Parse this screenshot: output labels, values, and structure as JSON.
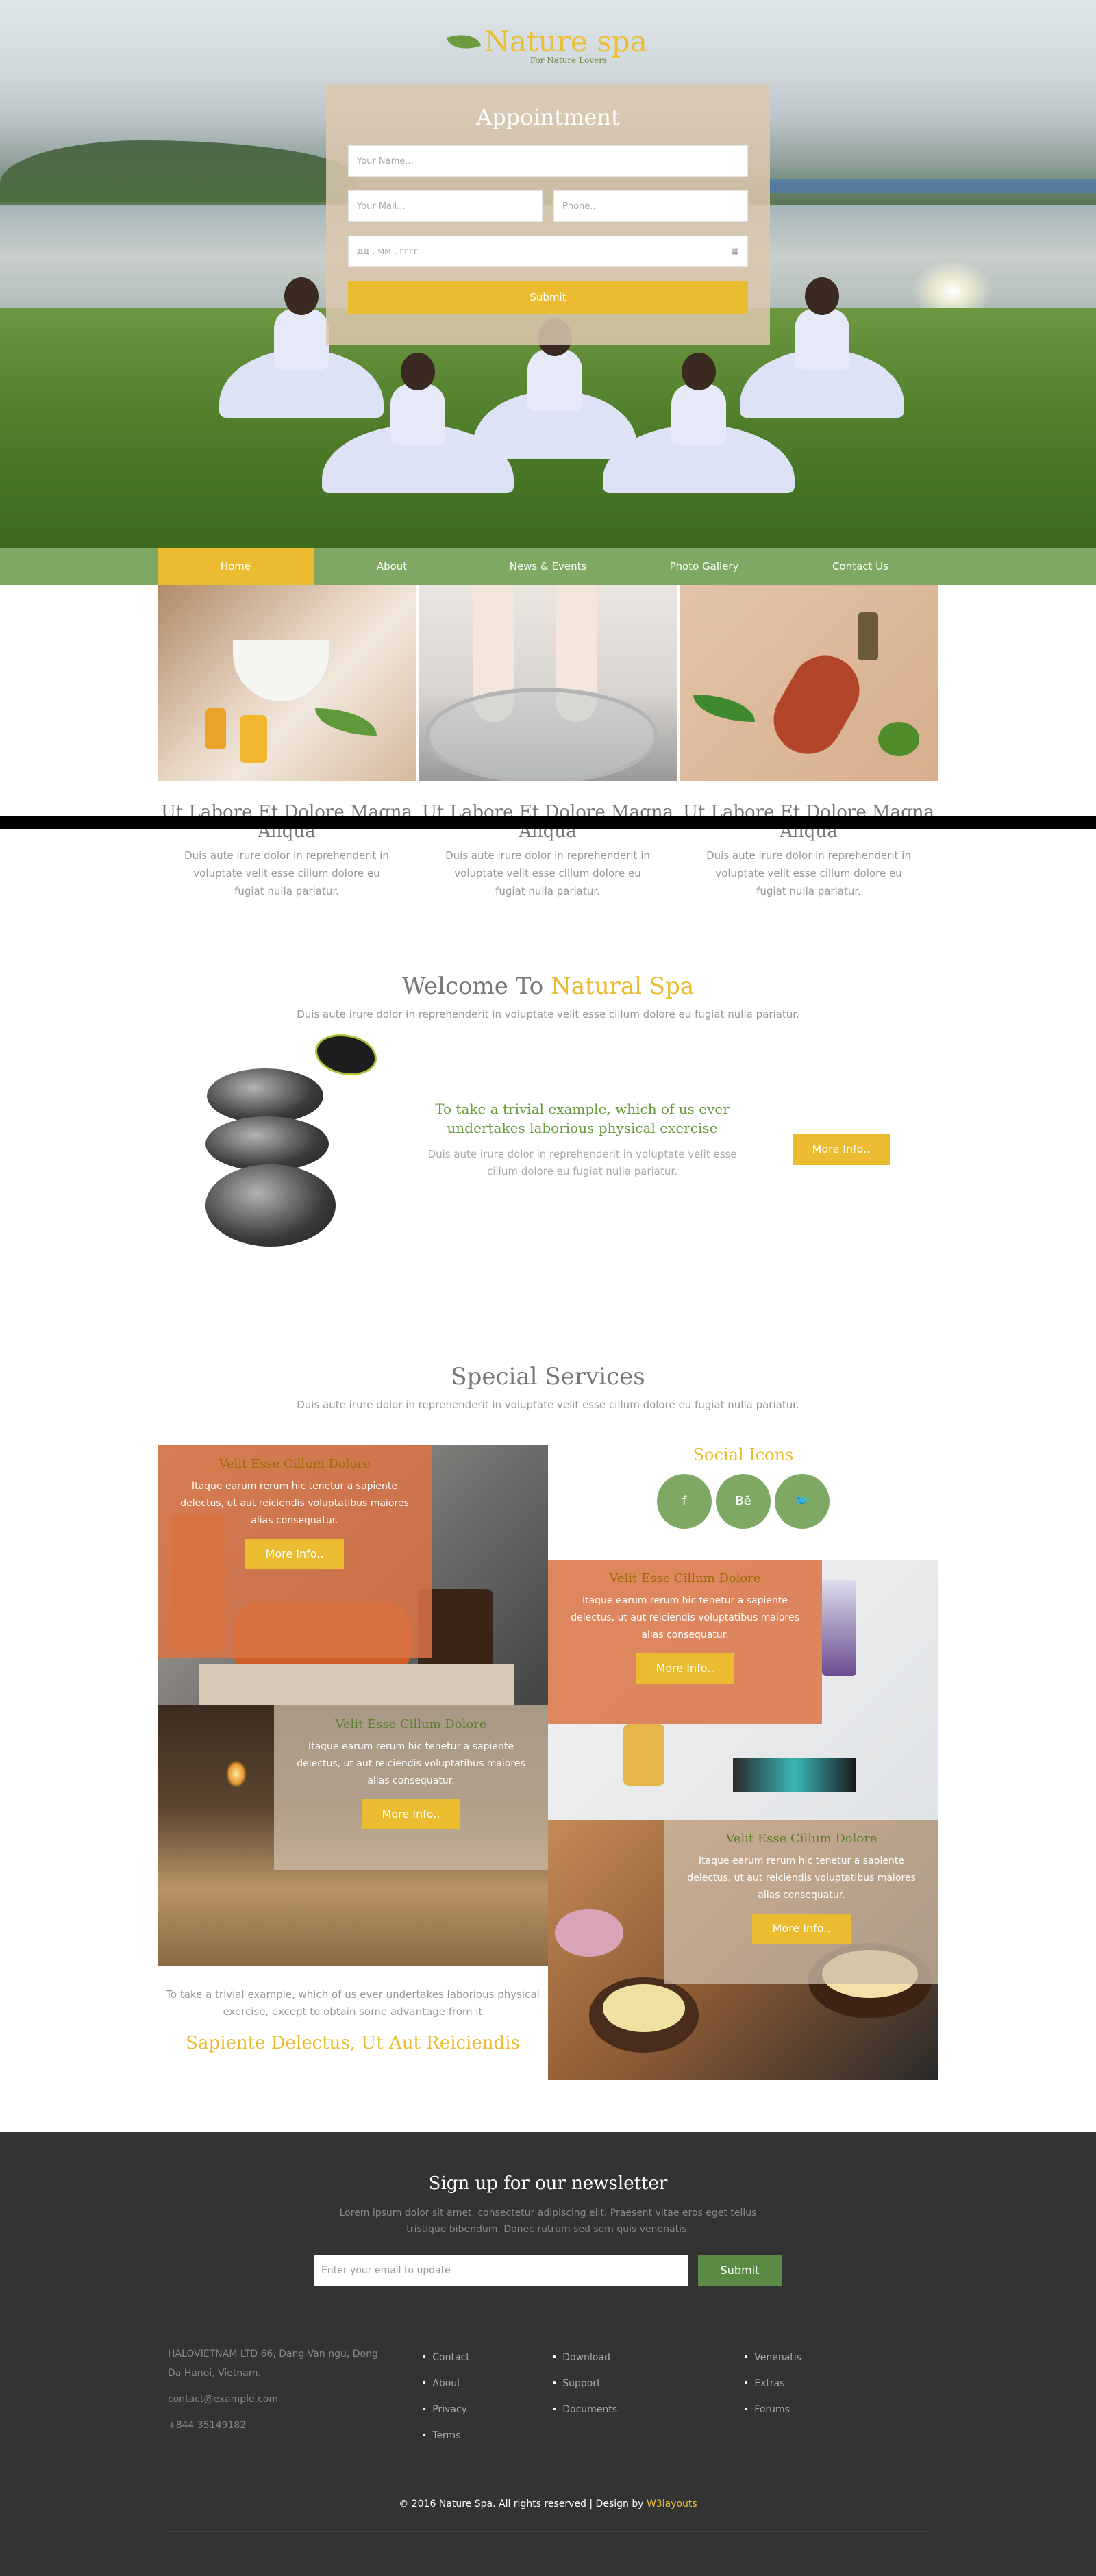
{
  "brand": {
    "name": "Nature spa",
    "tagline": "For Nature Lovers"
  },
  "appointment": {
    "title": "Appointment",
    "name_placeholder": "Your Name...",
    "mail_placeholder": "Your Mail...",
    "phone_placeholder": "Phone...",
    "date_placeholder": "дд . мм . гггг",
    "submit_label": "Submit"
  },
  "nav": {
    "items": [
      "Home",
      "About",
      "News & Events",
      "Photo Gallery",
      "Contact Us"
    ],
    "active": "Home"
  },
  "features": [
    {
      "title": "Ut Labore Et Dolore Magna Aliqua",
      "text": "Duis aute irure dolor in reprehenderit in voluptate velit esse cillum dolore eu fugiat nulla pariatur."
    },
    {
      "title": "Ut Labore Et Dolore Magna Aliqua",
      "text": "Duis aute irure dolor in reprehenderit in voluptate velit esse cillum dolore eu fugiat nulla pariatur."
    },
    {
      "title": "Ut Labore Et Dolore Magna Aliqua",
      "text": "Duis aute irure dolor in reprehenderit in voluptate velit esse cillum dolore eu fugiat nulla pariatur."
    }
  ],
  "welcome": {
    "title_prefix": "Welcome To ",
    "title_highlight": "Natural Spa",
    "subtitle": "Duis aute irure dolor in reprehenderit in voluptate velit esse cillum dolore eu fugiat nulla pariatur.",
    "heading": "To take a trivial example, which of us ever undertakes laborious physical exercise",
    "text": "Duis aute irure dolor in reprehenderit in voluptate velit esse cillum dolore eu fugiat nulla pariatur.",
    "button": "More Info.."
  },
  "special": {
    "title": "Special Services",
    "subtitle": "Duis aute irure dolor in reprehenderit in voluptate velit esse cillum dolore eu fugiat nulla pariatur.",
    "service_title": "Velit Esse Cillum Dolore",
    "service_text": "Itaque earum rerum hic tenetur a sapiente delectus, ut aut reiciendis voluptatibus maiores alias consequatur.",
    "button": "More Info..",
    "social_title": "Social Icons",
    "social": [
      "f",
      "Bē",
      "🐦"
    ],
    "bottom_text": "To take a trivial example, which of us ever undertakes laborious physical exercise, except to obtain some advantage from it",
    "bottom_heading": "Sapiente Delectus, Ut Aut Reiciendis"
  },
  "newsletter": {
    "title": "Sign up for our newsletter",
    "text": "Lorem ipsum dolor sit amet, consectetur adipiscing elit. Praesent vitae eros eget tellus tristique bibendum. Donec rutrum sed sem quis venenatis.",
    "placeholder": "Enter your email to update",
    "submit": "Submit"
  },
  "footer": {
    "address": "HALOVIETNAM LTD 66, Dang Van ngu, Dong Da Hanoi, Vietnam.",
    "email": "contact@example.com",
    "phone": "+844 35149182",
    "col1": [
      "Contact",
      "About",
      "Privacy",
      "Terms"
    ],
    "col2": [
      "Download",
      "Support",
      "Documents"
    ],
    "col3": [
      "Venenatis",
      "Extras",
      "Forums"
    ],
    "copyright": "© 2016 Nature Spa. All rights reserved | Design by ",
    "designer": "W3layouts"
  },
  "colors": {
    "accent": "#ebbc2f",
    "green": "#7ea863",
    "dark": "#333333"
  }
}
